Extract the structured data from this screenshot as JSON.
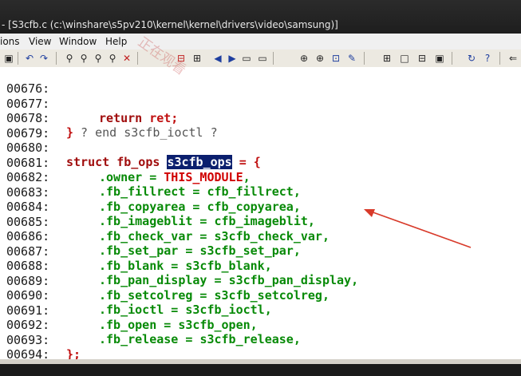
{
  "window": {
    "title": "- [S3cfb.c (c:\\winshare\\s5pv210\\kernel\\kernel\\drivers\\video\\samsung)]"
  },
  "menu": {
    "items": [
      "ions",
      "View",
      "Window",
      "Help"
    ]
  },
  "editor": {
    "lines": [
      {
        "num": "00676:",
        "text": ""
      },
      {
        "num": "00677:",
        "text": "return ret;"
      },
      {
        "num": "00678:",
        "text": "} ? end s3cfb_ioctl ?"
      },
      {
        "num": "00679:",
        "text": ""
      },
      {
        "num": "00680:",
        "text": "struct fb_ops s3cfb_ops = {"
      },
      {
        "num": "00681:",
        "text": ".owner = THIS_MODULE,"
      },
      {
        "num": "00682:",
        "text": ".fb_fillrect = cfb_fillrect,"
      },
      {
        "num": "00683:",
        "text": ".fb_copyarea = cfb_copyarea,"
      },
      {
        "num": "00684:",
        "text": ".fb_imageblit = cfb_imageblit,"
      },
      {
        "num": "00685:",
        "text": ".fb_check_var = s3cfb_check_var,"
      },
      {
        "num": "00686:",
        "text": ".fb_set_par = s3cfb_set_par,"
      },
      {
        "num": "00687:",
        "text": ".fb_blank = s3cfb_blank,"
      },
      {
        "num": "00688:",
        "text": ".fb_pan_display = s3cfb_pan_display,"
      },
      {
        "num": "00689:",
        "text": ".fb_setcolreg = s3cfb_setcolreg,"
      },
      {
        "num": "00690:",
        "text": ".fb_ioctl = s3cfb_ioctl,"
      },
      {
        "num": "00691:",
        "text": ".fb_open = s3cfb_open,"
      },
      {
        "num": "00692:",
        "text": ".fb_release = s3cfb_release,"
      },
      {
        "num": "00693:",
        "text": "};"
      },
      {
        "num": "00694:",
        "text": ""
      }
    ],
    "tokens": {
      "return_kw": "return",
      "ret": " ret;",
      "close_brace": "}",
      "end_comment": " ? end s3cfb_ioctl ?",
      "struct_kw": "struct",
      "fb_ops": " fb_ops ",
      "selected": "s3cfb_ops",
      "assign_open": " = {",
      "owner_l": ".owner",
      "eq": " = ",
      "this_module": "THIS_MODULE",
      "comma": ",",
      "fill_l": ".fb_fillrect",
      "fill_r": "cfb_fillrect",
      "copy_l": ".fb_copyarea",
      "copy_r": "cfb_copyarea",
      "blit_l": ".fb_imageblit",
      "blit_r": "cfb_imageblit",
      "check_l": ".fb_check_var",
      "check_r": "s3cfb_check_var",
      "setpar_l": ".fb_set_par",
      "setpar_r": "s3cfb_set_par",
      "blank_l": ".fb_blank",
      "blank_r": "s3cfb_blank",
      "pan_l": ".fb_pan_display",
      "pan_r": "s3cfb_pan_display",
      "setcol_l": ".fb_setcolreg",
      "setcol_r": "s3cfb_setcolreg",
      "ioctl_l": ".fb_ioctl",
      "ioctl_r": "s3cfb_ioctl",
      "open_l": ".fb_open",
      "open_r": "s3cfb_open",
      "release_l": ".fb_release",
      "release_r": "s3cfb_release",
      "end_brace": "};"
    }
  },
  "annotation": {
    "arrow_color": "#d83a2a"
  },
  "watermark": {
    "text": "正在观看"
  }
}
